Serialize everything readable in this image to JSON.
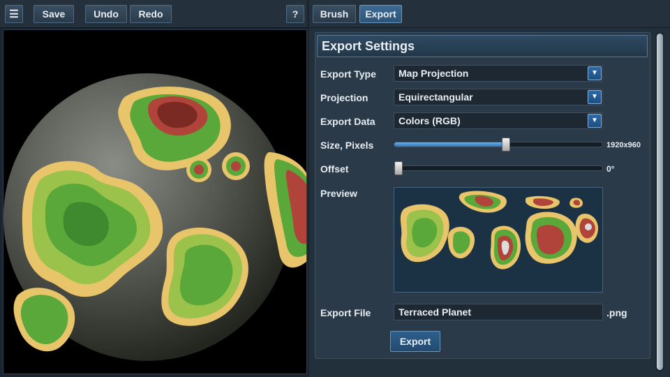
{
  "toolbar": {
    "menu_icon": "hamburger-menu-icon",
    "save_label": "Save",
    "undo_label": "Undo",
    "redo_label": "Redo",
    "help_label": "?"
  },
  "tabs": [
    {
      "label": "Brush",
      "active": false
    },
    {
      "label": "Export",
      "active": true
    }
  ],
  "panel": {
    "title": "Export Settings",
    "export_type": {
      "label": "Export Type",
      "value": "Map Projection"
    },
    "projection": {
      "label": "Projection",
      "value": "Equirectangular"
    },
    "export_data": {
      "label": "Export Data",
      "value": "Colors (RGB)"
    },
    "size": {
      "label": "Size, Pixels",
      "value_text": "1920x960",
      "fraction": 0.54
    },
    "offset": {
      "label": "Offset",
      "value_text": "0°",
      "fraction": 0.0
    },
    "preview_label": "Preview",
    "export_file": {
      "label": "Export File",
      "value": "Terraced Planet",
      "extension": ".png"
    },
    "export_button": "Export"
  },
  "dropdown_arrow_icon": "triangle-down-icon",
  "colors": {
    "accent": "#2f6aa6",
    "panel_bg": "#2a3a48",
    "toolbar_bg": "#24313d",
    "ocean": "#1a3244",
    "land_green": "#5aa83a",
    "land_sand": "#e8c46a",
    "land_red": "#b0443a"
  }
}
